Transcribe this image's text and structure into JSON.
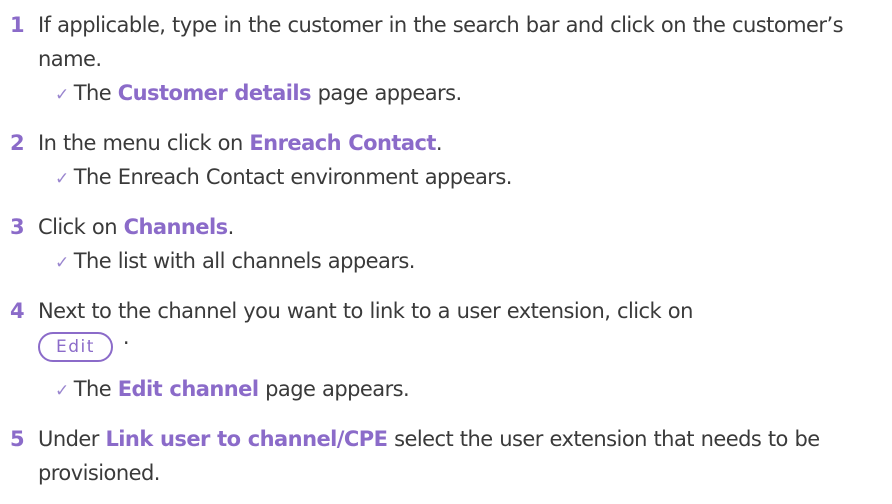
{
  "steps": [
    {
      "num": "1",
      "parts": [
        "If applicable, type in the customer in the search bar and click on the customer’s name."
      ],
      "result": {
        "pre": "The ",
        "hl": "Customer details",
        "post": " page appears."
      }
    },
    {
      "num": "2",
      "pre": "In the menu click on ",
      "hl": "Enreach Contact",
      "post": ".",
      "result": {
        "text": "The Enreach Contact environment appears."
      }
    },
    {
      "num": "3",
      "pre": "Click on ",
      "hl": "Channels",
      "post": ".",
      "result": {
        "text": "The list with all channels appears."
      }
    },
    {
      "num": "4",
      "text": "Next to the channel you want to link to a user extension, click on",
      "button_label": "Edit",
      "after_button": "·",
      "result": {
        "pre": "The ",
        "hl": "Edit channel",
        "post": " page appears."
      }
    },
    {
      "num": "5",
      "pre": "Under ",
      "hl": "Link user to channel/CPE",
      "post": " select the user extension that needs to be provisioned."
    }
  ],
  "check_symbol": "✓",
  "colors": {
    "accent": "#8b6bc9",
    "text": "#3a3a3a"
  }
}
